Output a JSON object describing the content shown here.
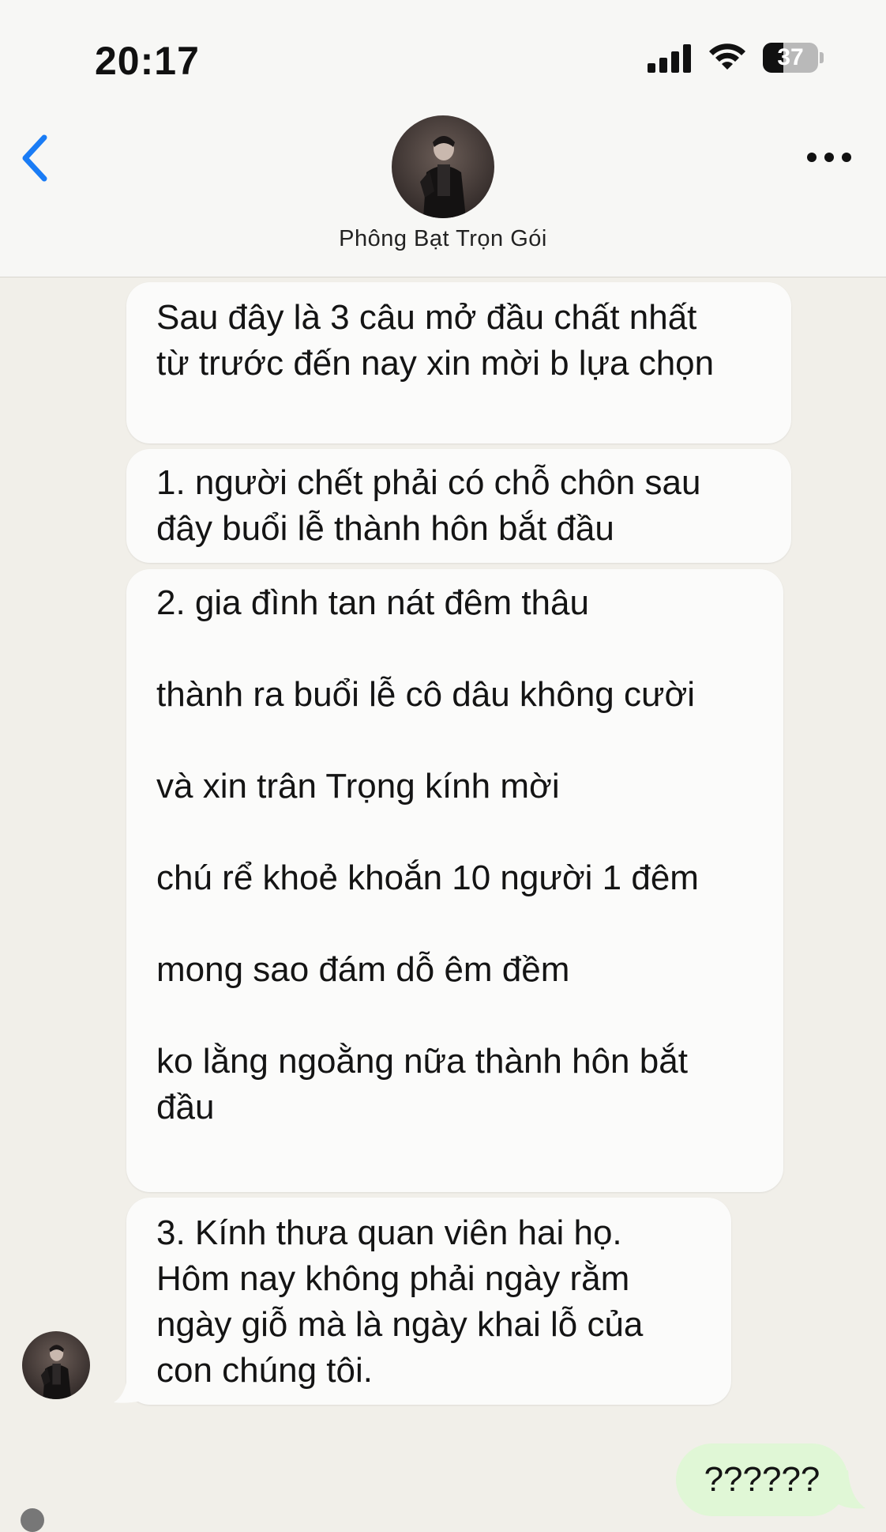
{
  "status_bar": {
    "time": "20:17",
    "battery_level": "37",
    "battery_fraction": 0.37
  },
  "header": {
    "back_icon": "chevron-left-icon",
    "more_icon": "ellipsis-icon",
    "contact_name": "Phông Bạt Trọn Gói",
    "accent_color": "#1a7cf5"
  },
  "messages": [
    {
      "lines": [
        "Sau đây là 3 câu mở đầu chất nhất",
        "từ trước đến nay xin mời b lựa chọn"
      ]
    },
    {
      "lines": [
        "1. người chết phải có chỗ chôn sau",
        "đây buổi lễ thành hôn bắt đầu"
      ]
    },
    {
      "lines": [
        "2. gia đình tan nát đêm thâu",
        "",
        "thành ra buổi lễ cô dâu không cười",
        "",
        "và xin trân Trọng kính mời",
        "",
        "chú rể khoẻ khoắn 10 người 1 đêm",
        "",
        "mong sao đám dỗ êm đềm",
        "",
        "ko lằng ngoằng nữa thành hôn bắt",
        "đầu"
      ]
    },
    {
      "lines": [
        "3. Kính thưa quan viên hai họ.",
        "Hôm nay không phải ngày rằm",
        "ngày giỗ mà là ngày khai lỗ của",
        "con chúng tôi."
      ]
    }
  ],
  "sent_message": {
    "text": "??????",
    "bubble_color": "#e0f7d6"
  }
}
